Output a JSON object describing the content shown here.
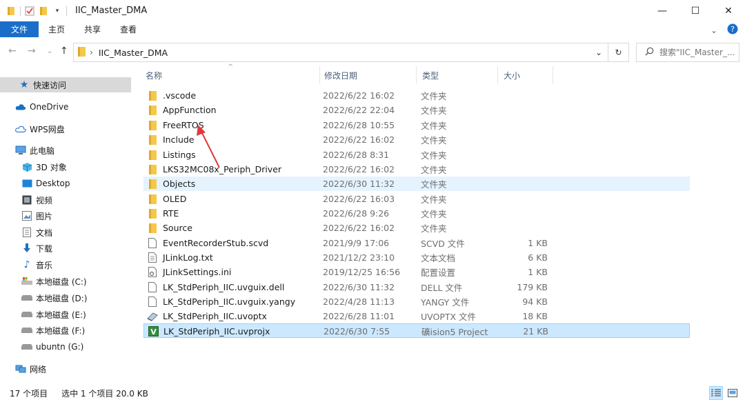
{
  "window": {
    "title": "IIC_Master_DMA",
    "minimize": "—",
    "maximize": "☐",
    "close": "✕"
  },
  "ribbon": {
    "tabs": [
      "文件",
      "主页",
      "共享",
      "查看"
    ]
  },
  "address": {
    "path": "IIC_Master_DMA",
    "search_placeholder": "搜索\"IIC_Master_..."
  },
  "nav": {
    "quick_access": "快速访问",
    "onedrive": "OneDrive",
    "wps": "WPS网盘",
    "this_pc": "此电脑",
    "items": [
      {
        "label": "3D 对象",
        "icon": "3d-objects-icon"
      },
      {
        "label": "Desktop",
        "icon": "desktop-icon"
      },
      {
        "label": "视频",
        "icon": "video-icon"
      },
      {
        "label": "图片",
        "icon": "pictures-icon"
      },
      {
        "label": "文档",
        "icon": "documents-icon"
      },
      {
        "label": "下载",
        "icon": "download-icon"
      },
      {
        "label": "音乐",
        "icon": "music-icon"
      },
      {
        "label": "本地磁盘 (C:)",
        "icon": "drive-c-icon"
      },
      {
        "label": "本地磁盘 (D:)",
        "icon": "drive-icon"
      },
      {
        "label": "本地磁盘 (E:)",
        "icon": "drive-icon"
      },
      {
        "label": "本地磁盘 (F:)",
        "icon": "drive-icon"
      },
      {
        "label": "ubuntn (G:)",
        "icon": "drive-icon"
      }
    ],
    "network": "网络"
  },
  "columns": {
    "name": "名称",
    "date": "修改日期",
    "type": "类型",
    "size": "大小"
  },
  "files": [
    {
      "name": ".vscode",
      "date": "2022/6/22 16:02",
      "type": "文件夹",
      "size": "",
      "icon": "folder-icon"
    },
    {
      "name": "AppFunction",
      "date": "2022/6/22 22:04",
      "type": "文件夹",
      "size": "",
      "icon": "folder-icon"
    },
    {
      "name": "FreeRTOS",
      "date": "2022/6/28 10:55",
      "type": "文件夹",
      "size": "",
      "icon": "folder-icon"
    },
    {
      "name": "Include",
      "date": "2022/6/22 16:02",
      "type": "文件夹",
      "size": "",
      "icon": "folder-icon"
    },
    {
      "name": "Listings",
      "date": "2022/6/28 8:31",
      "type": "文件夹",
      "size": "",
      "icon": "folder-icon"
    },
    {
      "name": "LKS32MC08x_Periph_Driver",
      "date": "2022/6/22 16:02",
      "type": "文件夹",
      "size": "",
      "icon": "folder-icon"
    },
    {
      "name": "Objects",
      "date": "2022/6/30 11:32",
      "type": "文件夹",
      "size": "",
      "icon": "folder-icon"
    },
    {
      "name": "OLED",
      "date": "2022/6/22 16:03",
      "type": "文件夹",
      "size": "",
      "icon": "folder-icon"
    },
    {
      "name": "RTE",
      "date": "2022/6/28 9:26",
      "type": "文件夹",
      "size": "",
      "icon": "folder-icon"
    },
    {
      "name": "Source",
      "date": "2022/6/22 16:02",
      "type": "文件夹",
      "size": "",
      "icon": "folder-icon"
    },
    {
      "name": "EventRecorderStub.scvd",
      "date": "2021/9/9 17:06",
      "type": "SCVD 文件",
      "size": "1 KB",
      "icon": "file-icon"
    },
    {
      "name": "JLinkLog.txt",
      "date": "2021/12/2 23:10",
      "type": "文本文档",
      "size": "6 KB",
      "icon": "text-file-icon"
    },
    {
      "name": "JLinkSettings.ini",
      "date": "2019/12/25 16:56",
      "type": "配置设置",
      "size": "1 KB",
      "icon": "settings-file-icon"
    },
    {
      "name": "LK_StdPeriph_IIC.uvguix.dell",
      "date": "2022/6/30 11:32",
      "type": "DELL 文件",
      "size": "179 KB",
      "icon": "file-icon"
    },
    {
      "name": "LK_StdPeriph_IIC.uvguix.yangy",
      "date": "2022/4/28 11:13",
      "type": "YANGY 文件",
      "size": "94 KB",
      "icon": "file-icon"
    },
    {
      "name": "LK_StdPeriph_IIC.uvoptx",
      "date": "2022/6/28 11:01",
      "type": "UVOPTX 文件",
      "size": "18 KB",
      "icon": "uvoptx-file-icon"
    },
    {
      "name": "LK_StdPeriph_IIC.uvprojx",
      "date": "2022/6/30 7:55",
      "type": "礦ision5 Project",
      "size": "21 KB",
      "icon": "keil-project-icon"
    }
  ],
  "status": {
    "count": "17 个项目",
    "selection": "选中 1 个项目  20.0 KB"
  },
  "colors": {
    "accent": "#1a6ec9",
    "selected_row": "#cce8ff",
    "hover_row": "#e5f3ff",
    "nav_selected": "#d9d9d9",
    "annotation_arrow": "#e0393e",
    "folder": "#f4c84a"
  }
}
